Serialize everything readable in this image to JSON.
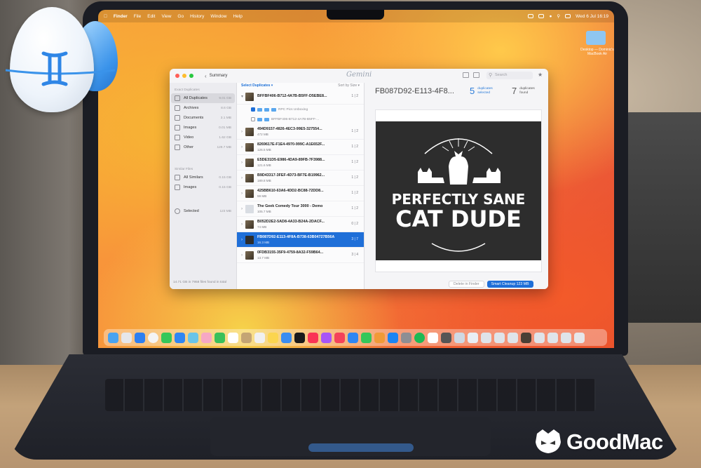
{
  "menubar": {
    "app_name": "Finder",
    "menus": [
      "File",
      "Edit",
      "View",
      "Go",
      "History",
      "Window",
      "Help"
    ],
    "clock": "Wed 6 Jul  16:19"
  },
  "desktop": {
    "folder_label": "Desktop — Dominic's MacBook Air"
  },
  "window": {
    "back_label": "Summary",
    "logo_text": "Gemini",
    "search_placeholder": "Search"
  },
  "sidebar": {
    "section_duplicates": "Exact Duplicates",
    "duplicates": [
      {
        "label": "All Duplicates",
        "size": "9.01 GB",
        "active": true
      },
      {
        "label": "Archives",
        "size": "8.6 GB"
      },
      {
        "label": "Documents",
        "size": "3.1 MB"
      },
      {
        "label": "Images",
        "size": "0.01 MB"
      },
      {
        "label": "Video",
        "size": "1.62 GB"
      },
      {
        "label": "Other",
        "size": "129.7 MB"
      }
    ],
    "section_similar": "Similar Files",
    "similar": [
      {
        "label": "All Similars",
        "size": "0.15 GB"
      },
      {
        "label": "Images",
        "size": "0.15 GB"
      }
    ],
    "selected": {
      "label": "Selected",
      "size": "123 MB"
    },
    "footer": "14.71 GB in 7958 files found in total"
  },
  "middle": {
    "select_label": "Select Duplicates ▾",
    "sort_label": "Sort by Size ▾",
    "expanded": {
      "name": "BFFBF406-B712-4A7B-B5FF-D5EBE8...",
      "ratio": "1 | 2",
      "path1": "RPC Pics Unboxing",
      "path2": "BFFBF406-B712-4A7B-B5FF-..."
    },
    "rows": [
      {
        "name": "494D9157-4826-4EC3-99E5-327554...",
        "size": "472 MB",
        "ratio": "1 | 2"
      },
      {
        "name": "8269617E-F1E4-4970-999C-A1E652F...",
        "size": "126.5 MB",
        "ratio": "1 | 2"
      },
      {
        "name": "E5DE31D5-E986-4DA9-89FB-7F3988...",
        "size": "121.6 MB",
        "ratio": "1 | 2"
      },
      {
        "name": "B9D43317-3FEF-4D73-BF7E-B19962...",
        "size": "189.8 MB",
        "ratio": "1 | 2"
      },
      {
        "name": "425BB610-63A6-4DD2-BC88-72DD8...",
        "size": "59 MB",
        "ratio": "1 | 2"
      },
      {
        "name": "The Geek Comedy Tour 3000 - Demo",
        "size": "105.7 MB",
        "ratio": "1 | 2"
      },
      {
        "name": "B052D2E2-5AD8-4A33-B24A-2DACF...",
        "size": "74 MB",
        "ratio": "0 | 2"
      },
      {
        "name": "FB087D92-E113-4F8A-B738-63B04727B56A",
        "size": "16.3 MB",
        "ratio": "3 | 7",
        "selected": true
      },
      {
        "name": "0FDB3155-35F9-4759-8A32-F59B64...",
        "size": "13.7 MB",
        "ratio": "3 | 4"
      }
    ]
  },
  "detail": {
    "title": "FB087D92-E113-4F8...",
    "selected_count": "5",
    "selected_label_1": "duplicates",
    "selected_label_2": "selected",
    "found_count": "7",
    "found_label_1": "duplicates",
    "found_label_2": "found",
    "preview": {
      "line1": "PERFECTLY SANE",
      "line2": "CAT DUDE"
    }
  },
  "footer_buttons": {
    "delete_label": "Delete in Finder",
    "cleanup_label": "Smart Cleanup 123 MB"
  },
  "brand": {
    "text": "GoodMac"
  },
  "colors": {
    "accent": "#1f6fd8",
    "preview_bg": "#2d2d2d",
    "wallpaper": "#f7903a"
  }
}
